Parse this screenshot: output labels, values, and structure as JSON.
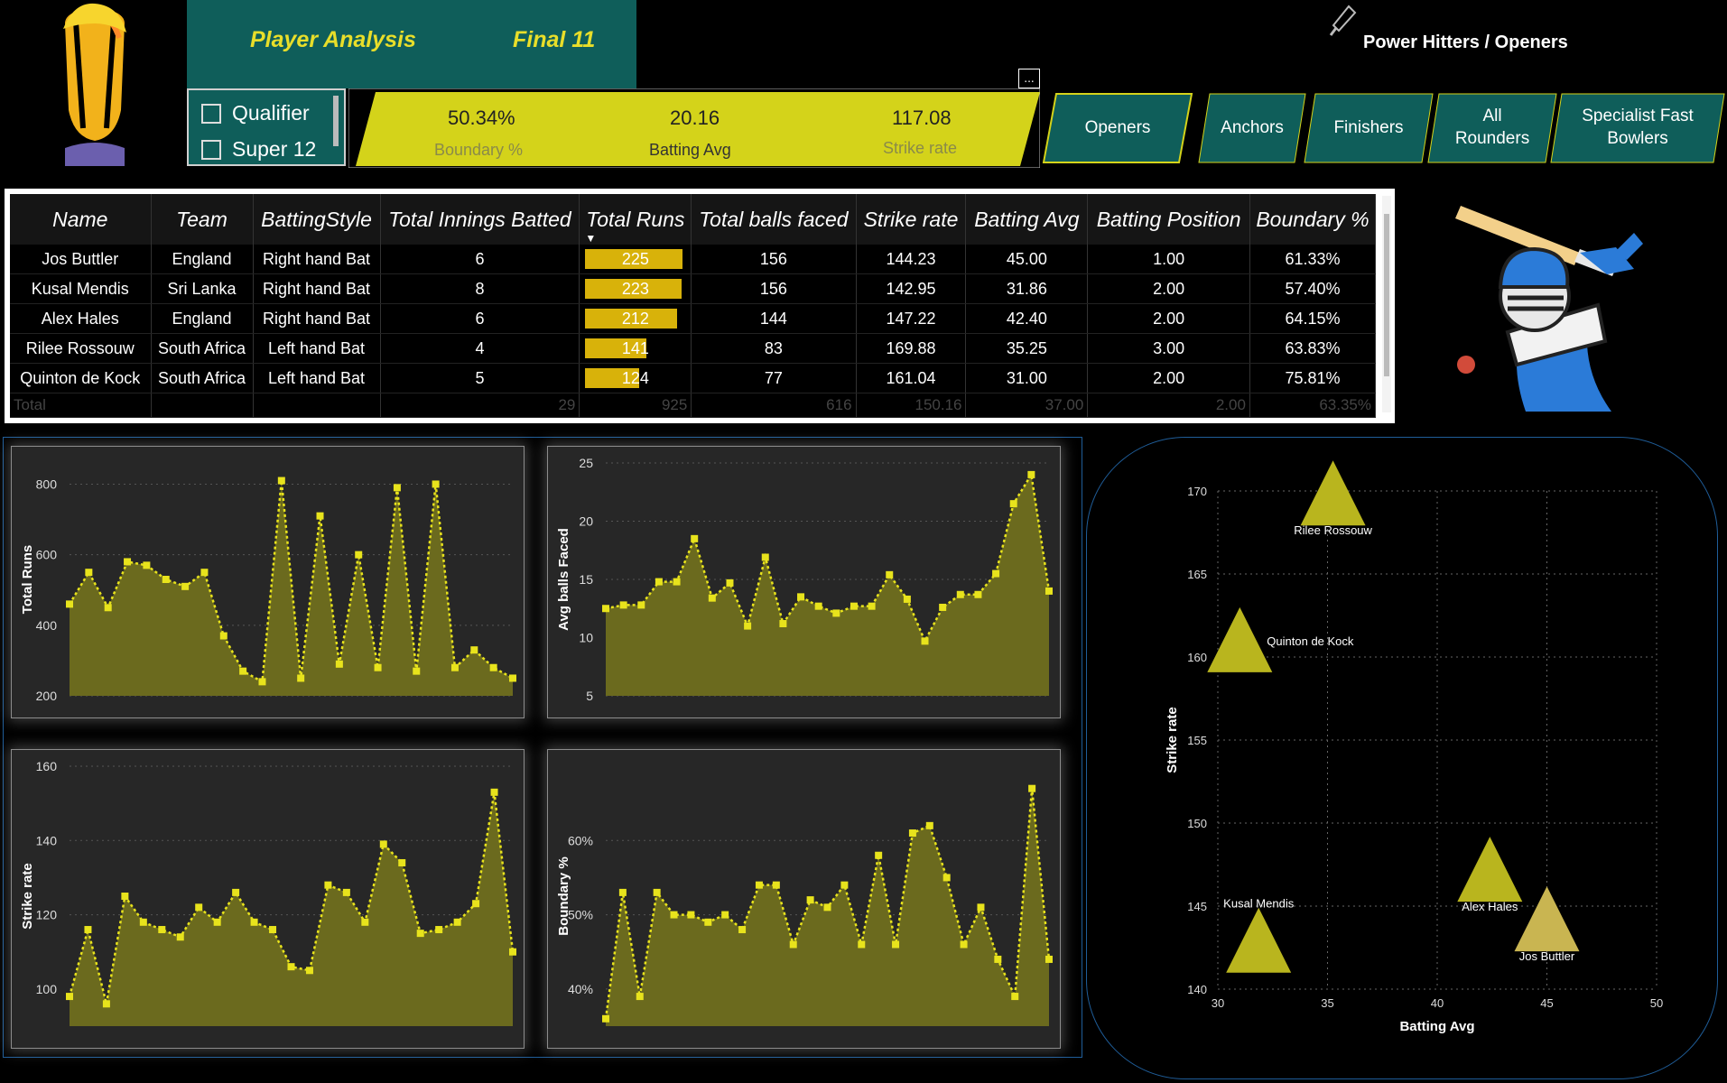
{
  "header": {
    "nav_links": [
      "Player Analysis",
      "Final 11"
    ],
    "page_title": "Power Hitters / Openers",
    "more_options": "..."
  },
  "slicer": {
    "items": [
      "Qualifier",
      "Super 12"
    ]
  },
  "kpis": [
    {
      "value": "50.34%",
      "label": "Boundary %"
    },
    {
      "value": "20.16",
      "label": "Batting Avg"
    },
    {
      "value": "117.08",
      "label": "Strike rate"
    }
  ],
  "roles": [
    "Openers",
    "Anchors",
    "Finishers",
    "All Rounders",
    "Specialist Fast Bowlers"
  ],
  "colors": {
    "teal": "#0f5e5a",
    "yellow": "#d4d31a",
    "olive": "#6b6a1e",
    "gold": "#d8b20a"
  },
  "table": {
    "columns": [
      "Name",
      "Team",
      "BattingStyle",
      "Total Innings Batted",
      "Total Runs",
      "Total balls faced",
      "Strike rate",
      "Batting Avg",
      "Batting Position",
      "Boundary %"
    ],
    "rows": [
      [
        "Jos Buttler",
        "England",
        "Right hand Bat",
        "6",
        "225",
        "156",
        "144.23",
        "45.00",
        "1.00",
        "61.33%"
      ],
      [
        "Kusal Mendis",
        "Sri Lanka",
        "Right hand Bat",
        "8",
        "223",
        "156",
        "142.95",
        "31.86",
        "2.00",
        "57.40%"
      ],
      [
        "Alex Hales",
        "England",
        "Right hand Bat",
        "6",
        "212",
        "144",
        "147.22",
        "42.40",
        "2.00",
        "64.15%"
      ],
      [
        "Rilee Rossouw",
        "South Africa",
        "Left hand Bat",
        "4",
        "141",
        "83",
        "169.88",
        "35.25",
        "3.00",
        "63.83%"
      ],
      [
        "Quinton de Kock",
        "South Africa",
        "Left hand Bat",
        "5",
        "124",
        "77",
        "161.04",
        "31.00",
        "2.00",
        "75.81%"
      ]
    ],
    "run_values": [
      225,
      223,
      212,
      141,
      124
    ],
    "run_max": 225,
    "total": [
      "Total",
      "",
      "",
      "29",
      "925",
      "616",
      "150.16",
      "37.00",
      "2.00",
      "63.35%"
    ]
  },
  "chart_data": [
    {
      "type": "area",
      "title": "",
      "ylabel": "Total Runs",
      "ylim": [
        200,
        860
      ],
      "yticks": [
        200,
        400,
        600,
        800
      ],
      "values": [
        460,
        550,
        450,
        580,
        570,
        530,
        510,
        550,
        370,
        270,
        240,
        810,
        250,
        710,
        290,
        600,
        280,
        790,
        270,
        800,
        280,
        330,
        280,
        250
      ]
    },
    {
      "type": "area",
      "title": "",
      "ylabel": "Avg balls Faced",
      "ylim": [
        5,
        25
      ],
      "yticks": [
        5,
        10,
        15,
        20,
        25
      ],
      "values": [
        12.5,
        12.8,
        12.8,
        14.8,
        14.8,
        18.5,
        13.4,
        14.7,
        11,
        16.9,
        11.2,
        13.5,
        12.7,
        12.1,
        12.7,
        12.7,
        15.4,
        13.3,
        9.7,
        12.6,
        13.7,
        13.7,
        15.5,
        21.5,
        24,
        14
      ]
    },
    {
      "type": "area",
      "title": "",
      "ylabel": "Strike rate",
      "ylim": [
        90,
        160
      ],
      "yticks": [
        100,
        120,
        140,
        160
      ],
      "values": [
        98,
        116,
        96,
        125,
        118,
        116,
        114,
        122,
        118,
        126,
        118,
        116,
        106,
        105,
        128,
        126,
        118,
        139,
        134,
        115,
        116,
        118,
        123,
        153,
        110
      ]
    },
    {
      "type": "area",
      "title": "",
      "ylabel": "Boundary %",
      "ylim": [
        35,
        70
      ],
      "yticks": [
        "40%",
        "50%",
        "60%"
      ],
      "ytick_values": [
        40,
        50,
        60
      ],
      "values": [
        36,
        53,
        39,
        53,
        50,
        50,
        49,
        50,
        48,
        54,
        54,
        46,
        52,
        51,
        54,
        46,
        58,
        46,
        61,
        62,
        55,
        46,
        51,
        44,
        39,
        67,
        44
      ]
    },
    {
      "type": "scatter",
      "title": "",
      "xlabel": "Batting Avg",
      "ylabel": "Strike rate",
      "xlim": [
        30,
        50
      ],
      "ylim": [
        140,
        170
      ],
      "xticks": [
        30,
        35,
        40,
        45,
        50
      ],
      "yticks": [
        140,
        145,
        150,
        155,
        160,
        165,
        170
      ],
      "points": [
        {
          "label": "Rilee Rossouw",
          "x": 35.25,
          "y": 169.88
        },
        {
          "label": "Quinton de Kock",
          "x": 31.0,
          "y": 161.04
        },
        {
          "label": "Kusal Mendis",
          "x": 31.86,
          "y": 142.95
        },
        {
          "label": "Alex Hales",
          "x": 42.4,
          "y": 147.22
        },
        {
          "label": "Jos Buttler",
          "x": 45.0,
          "y": 144.23
        }
      ]
    }
  ]
}
